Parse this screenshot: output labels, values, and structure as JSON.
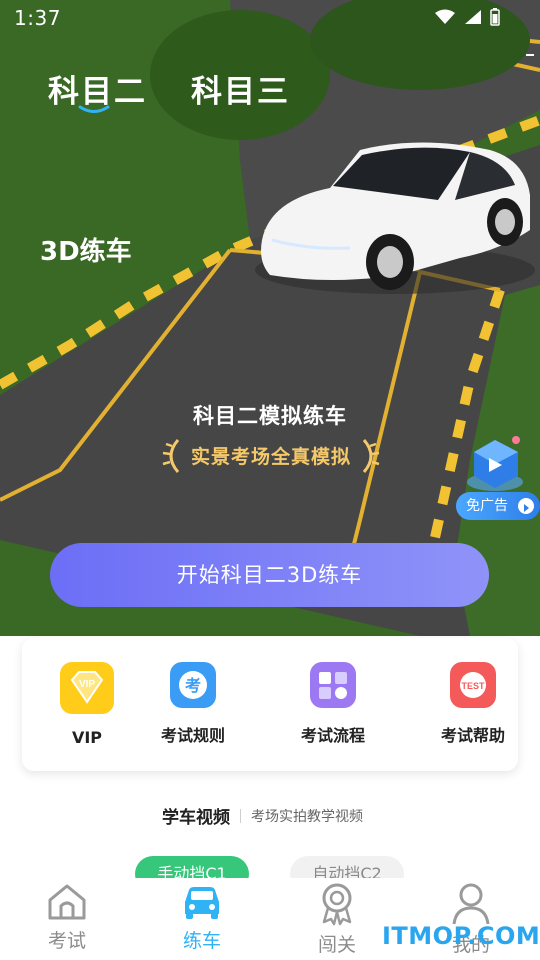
{
  "status_bar": {
    "time": "1:37"
  },
  "subject_tabs": [
    {
      "label": "科目二",
      "active": true
    },
    {
      "label": "科目三",
      "active": false
    }
  ],
  "hero": {
    "mode_label": "3D练车",
    "sim_title": "科目二模拟练车",
    "sim_subtitle": "实景考场全真模拟",
    "no_ads_label": "免广告",
    "start_button": "开始科目二3D练车"
  },
  "shortcuts": [
    {
      "label": "VIP",
      "icon": "vip-icon",
      "color": "#ffcc1a"
    },
    {
      "label": "考试规则",
      "icon": "rules-icon",
      "color": "#3b9cf5"
    },
    {
      "label": "考试流程",
      "icon": "process-icon",
      "color": "#9c78f3"
    },
    {
      "label": "考试帮助",
      "icon": "test-help-icon",
      "color": "#f45a5a"
    }
  ],
  "video_section": {
    "title": "学车视频",
    "subtitle": "考场实拍教学视频",
    "tabs": [
      {
        "label": "手动挡C1",
        "active": true
      },
      {
        "label": "自动挡C2",
        "active": false
      }
    ]
  },
  "bottom_nav": [
    {
      "label": "考试",
      "icon": "home-icon",
      "active": false
    },
    {
      "label": "练车",
      "icon": "car-icon",
      "active": true
    },
    {
      "label": "闯关",
      "icon": "badge-icon",
      "active": false
    },
    {
      "label": "我的",
      "icon": "profile-icon",
      "active": false
    }
  ],
  "watermark": "ITMOP.COM",
  "colors": {
    "accent": "#2fb3f5",
    "button": "#7b7ef7",
    "green_tab": "#36c77a",
    "gold": "#f5c96a"
  }
}
